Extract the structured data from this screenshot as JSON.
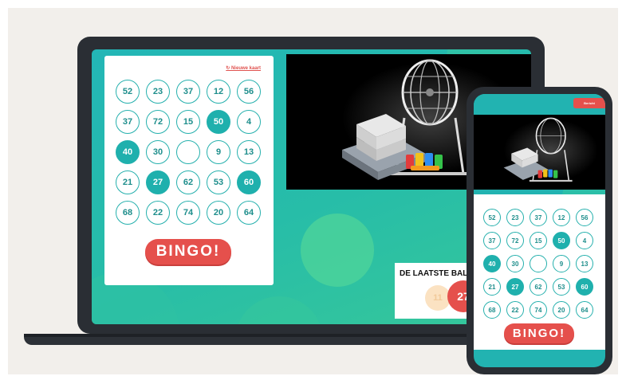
{
  "card": {
    "new_card_label": "↻ Nieuwe kaart",
    "cells": [
      {
        "value": "52",
        "marked": false
      },
      {
        "value": "23",
        "marked": false
      },
      {
        "value": "37",
        "marked": false
      },
      {
        "value": "12",
        "marked": false
      },
      {
        "value": "56",
        "marked": false
      },
      {
        "value": "37",
        "marked": false
      },
      {
        "value": "72",
        "marked": false
      },
      {
        "value": "15",
        "marked": false
      },
      {
        "value": "50",
        "marked": true
      },
      {
        "value": "4",
        "marked": false
      },
      {
        "value": "40",
        "marked": true
      },
      {
        "value": "30",
        "marked": false
      },
      {
        "value": "",
        "marked": false
      },
      {
        "value": "9",
        "marked": false
      },
      {
        "value": "13",
        "marked": false
      },
      {
        "value": "21",
        "marked": false
      },
      {
        "value": "27",
        "marked": true
      },
      {
        "value": "62",
        "marked": false
      },
      {
        "value": "53",
        "marked": false
      },
      {
        "value": "60",
        "marked": true
      },
      {
        "value": "68",
        "marked": false
      },
      {
        "value": "22",
        "marked": false
      },
      {
        "value": "74",
        "marked": false
      },
      {
        "value": "20",
        "marked": false
      },
      {
        "value": "64",
        "marked": false
      }
    ],
    "bingo_label": "BINGO!"
  },
  "last_balls": {
    "title": "DE LAATSTE BALLEN",
    "previous": "11",
    "latest": "27"
  },
  "phone": {
    "header_button_label": "Bericht"
  },
  "colors": {
    "teal": "#22b3b1",
    "marked": "#1fb0ad",
    "bingo_red": "#e5504c"
  }
}
